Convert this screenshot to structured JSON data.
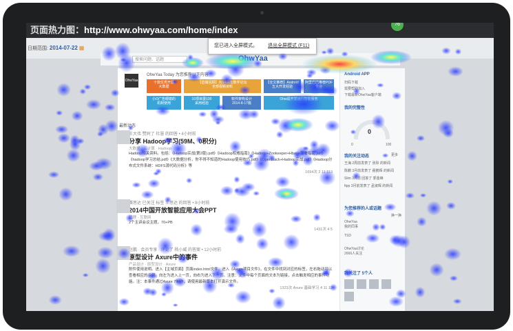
{
  "window": {
    "url_label": "页面热力图：",
    "url": "http://www.ohwyaa.com/home/index",
    "avatar_badge": "76"
  },
  "date_filter": {
    "label": "日期范围:",
    "value": "2014-07-22",
    "calendar_icon": "calendar-icon"
  },
  "fullscreen_tip": {
    "message": "您已进入全屏模式。",
    "exit_link": "退出全屏模式 (F11)"
  },
  "navbar": {
    "search_placeholder": "搜索问题、话题",
    "brand": "OhwYaa"
  },
  "site": {
    "header_text": "OhwYaa Today 为您推荐以下内容",
    "logo_text": "OhwYaa"
  },
  "tiles": [
    {
      "label": "十款优秀开源\n大数据",
      "color": "#e8702a"
    },
    {
      "label": "【直播回顾】2014青年数学论坛\n全部视频资料",
      "color": "#e8a33a"
    },
    {
      "label": "【全文推荐】Android\n五大开发经验",
      "color": "#4a7fc8"
    },
    {
      "label": "阿里巴巴推荐PDF\n整合",
      "color": "#4a7fc8"
    },
    {
      "label": "小O广告眼镜的\n机制使用",
      "color": "#3aa3d8"
    },
    {
      "label": "10项目录100\n采用经验",
      "color": "#3aa3d8"
    },
    {
      "label": "软件架构设计\n2014-8-17篇",
      "color": "#4a7fc8"
    },
    {
      "label": "Ohw是开发运行智能服务",
      "color": "#3aa3d8"
    }
  ],
  "feed_section": "最新动态",
  "posts": [
    {
      "meta": "王大伟  赞同了 杜慧 的回答 • 4小时前",
      "title": "分享 Hadoop学习(59M、0积分)",
      "sub": "大数据 · 云计算 · Hadoop",
      "body": "Hadoop相关资料。包括：《Hadoop实战(第2版).pdf》《Hadoop权威指南》《Hadoop+Zookeeper+Hbase部署指南.pdf》《hadoop学习总结.pdf》《大数据分析，你不得不知道的Hadoop使用技巧.pdf》《Openstack+Hadoop实战.pdf》《Hadoop分布式文件系统：HDFS源代码分析》等",
      "stats": "1694次  2  11  113"
    },
    {
      "meta": "赛思达  已关注  标签 王思达 的回答 • 8小时前",
      "title": "2014中国开放智能应用大会PPT",
      "sub": "管理 · 互联网",
      "body": "2个主讲会议主题，70+PB",
      "stats": "1431次  4  5"
    },
    {
      "meta": "赵鹏 · 会员专享 · 评论了 杨小威 的答案 • 12小时前",
      "title": "原型设计 Axure中的事件",
      "sub": "产品设计 · 原型设计 · Axure",
      "body": "附件使用说明。进入【主域页面】页面index.html文件，进入《Axure项目文件》，在文件中找到对应的标签，左右拖动可以查看相应的示例。向左为进入上一页，向右为进入下一页。注意：文件中每个页面的文本为链接，点击触发相应的事件功能。注：本事件通过Axure 7制作，请使用最新版本打开演示文件。",
      "stats": "1323次  Axure 基础学习  4  11  12"
    }
  ],
  "sidebar": {
    "app_title": "Android APP",
    "app_lines": [
      "扫码下载",
      "需要帮助加入",
      "下载最新OhwYaa客户端"
    ],
    "history_title": "我的完整性",
    "gauge_value": "0",
    "gauge_min": "0",
    "gauge_max": "100",
    "followed_title": "我的关注动态",
    "followed_more": "更多",
    "followed_items": [
      "王海  2周前发表了 张彤 的新闻",
      "陈鹏  3月前发表了 翟鹏辉 的新闻",
      "Slim  3月前 回答了 郭金峰",
      "ftpp  3月前发表了 孟淑辉 的新闻"
    ],
    "recommend_title": "为您推荐的人或话题",
    "recommend_more": "换一换",
    "recommend_items": [
      "OhwYaa\n我的同事",
      "TSD",
      "OhwYaa讨论\n2666人关注"
    ],
    "follow_label": "我关注了 5个人",
    "follow_action": "关注"
  },
  "colors": {
    "urlbar": "#2b2d30",
    "brand_blue": "#2a5ea8",
    "bezel": "#1e1f21",
    "avatar_badge": "#4caf50"
  }
}
